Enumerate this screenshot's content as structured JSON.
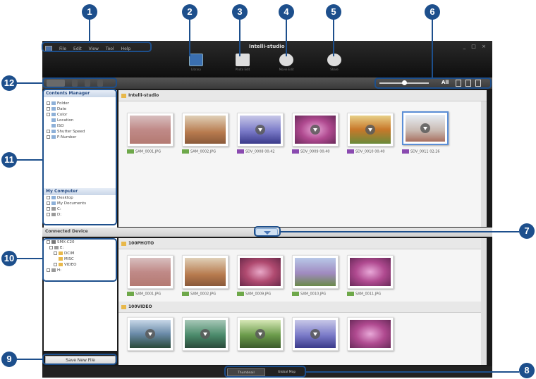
{
  "app": {
    "brand": "Intelli-studio",
    "menu": [
      "File",
      "Edit",
      "View",
      "Tool",
      "Help"
    ],
    "window_controls": "_ □ ×"
  },
  "modes": [
    {
      "label": "Library",
      "icon": "library-icon",
      "color": "#3a6fb0"
    },
    {
      "label": "Photo Edit",
      "icon": "photo-edit-icon",
      "color": "#ddd"
    },
    {
      "label": "Movie Edit",
      "icon": "movie-edit-icon",
      "color": "#ddd"
    },
    {
      "label": "Share",
      "icon": "share-globe-icon",
      "color": "#ddd"
    }
  ],
  "view_controls": {
    "all_label": "All"
  },
  "contents_manager": {
    "title": "Contents Manager",
    "items": [
      "Folder",
      "Date",
      "Color",
      "Location",
      "ISO",
      "Shutter Speed",
      "F-Number"
    ]
  },
  "my_computer": {
    "title": "My Computer",
    "items": [
      "Desktop",
      "My Documents",
      "C:",
      "D:"
    ]
  },
  "library": {
    "folder": "Intelli-studio",
    "files": [
      {
        "name": "SAM_0001.JPG",
        "duration": "",
        "kind": "photo"
      },
      {
        "name": "SAM_0002.JPG",
        "duration": "",
        "kind": "photo"
      },
      {
        "name": "SDV_0008",
        "duration": "00:42",
        "kind": "video"
      },
      {
        "name": "SDV_0009",
        "duration": "00:40",
        "kind": "video"
      },
      {
        "name": "SDV_0010",
        "duration": "00:40",
        "kind": "video"
      },
      {
        "name": "SDV_0011",
        "duration": "02:26",
        "kind": "video"
      }
    ]
  },
  "connected_device": {
    "title": "Connected Device",
    "tree": [
      "SMX-C20",
      "E:",
      "DCIM",
      "MISC",
      "VIDEO",
      "H:"
    ],
    "photo_folder": "100PHOTO",
    "photo_files": [
      "SAM_0001.JPG",
      "SAM_0002.JPG",
      "SAM_0009.JPG",
      "SAM_0010.JPG",
      "SAM_0011.JPG"
    ],
    "video_folder": "100VIDEO",
    "save_label": "Save New File"
  },
  "status_buttons": [
    "Thumbnail",
    "Global Map"
  ],
  "callouts": [
    "1",
    "2",
    "3",
    "4",
    "5",
    "6",
    "7",
    "8",
    "9",
    "10",
    "11",
    "12"
  ]
}
